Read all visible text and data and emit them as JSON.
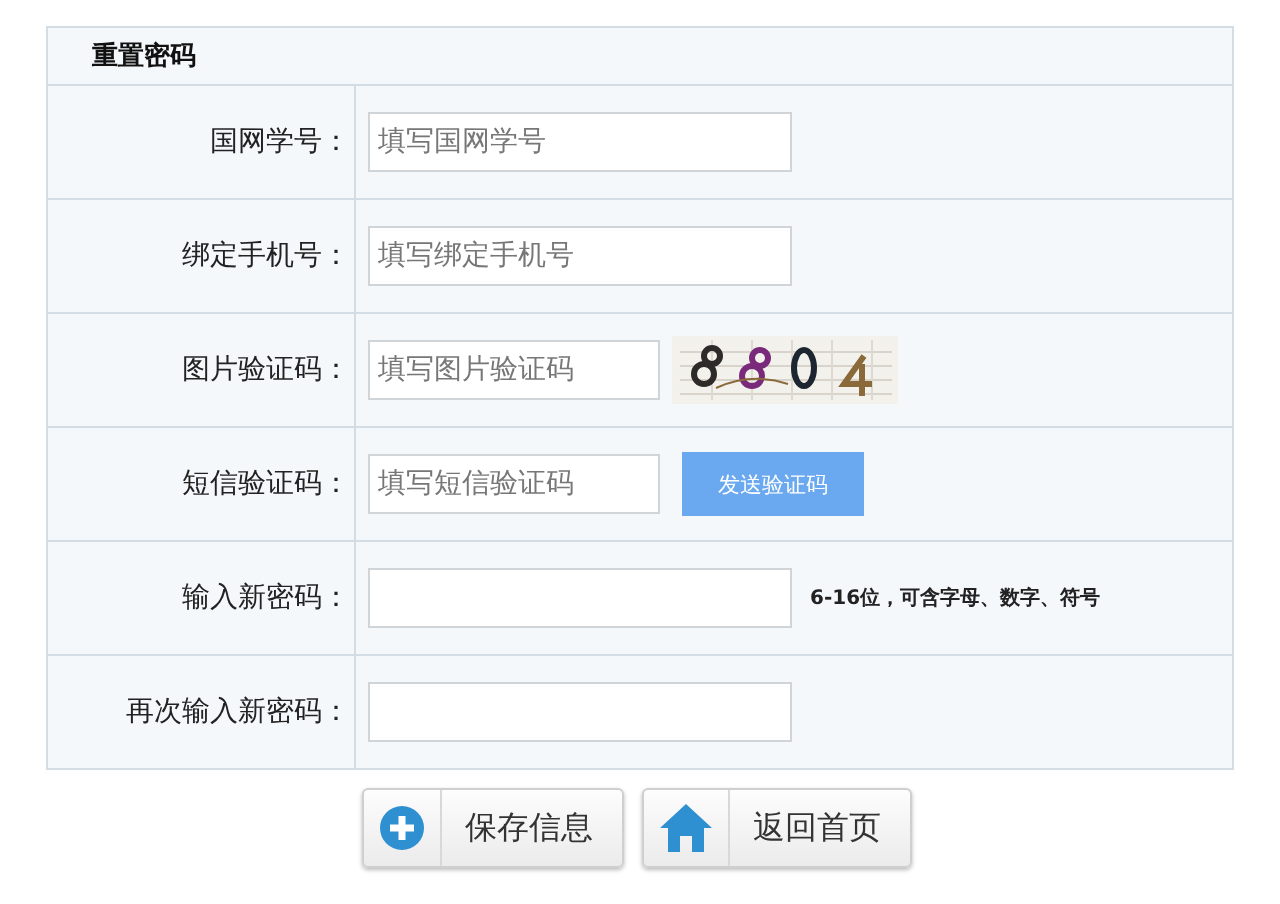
{
  "form": {
    "title": "重置密码",
    "rows": [
      {
        "kind": "plain",
        "label": "国网学号：",
        "placeholder": "填写国网学号"
      },
      {
        "kind": "plain",
        "label": "绑定手机号：",
        "placeholder": "填写绑定手机号"
      },
      {
        "kind": "captcha",
        "label": "图片验证码：",
        "placeholder": "填写图片验证码"
      },
      {
        "kind": "sms",
        "label": "短信验证码：",
        "placeholder": "填写短信验证码",
        "button": "发送验证码"
      },
      {
        "kind": "plain",
        "label": "输入新密码：",
        "hint": "6-16位，可含字母、数字、符号"
      },
      {
        "kind": "plain",
        "label": "再次输入新密码："
      }
    ]
  },
  "buttons": [
    {
      "kind": "add",
      "label": "保存信息"
    },
    {
      "kind": "home",
      "label": "返回首页"
    }
  ]
}
